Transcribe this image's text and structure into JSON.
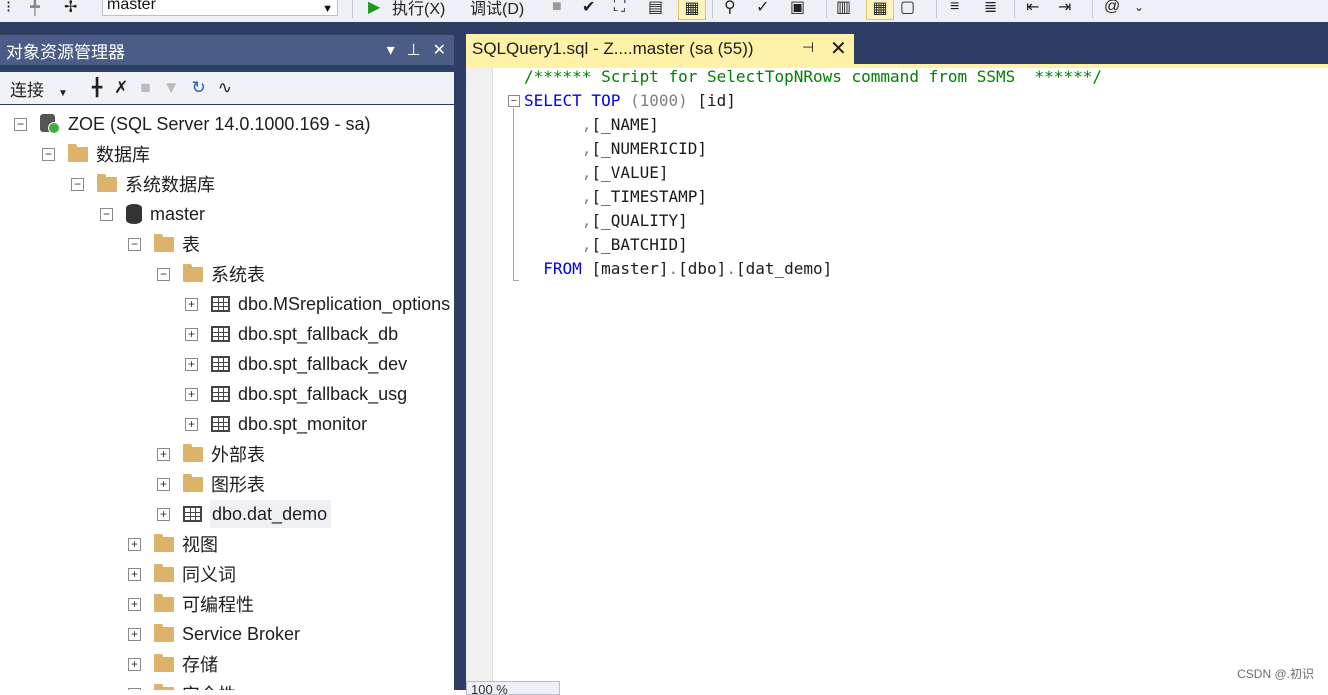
{
  "toolbar": {
    "database_combo": "master",
    "execute_label": "执行(X)",
    "debug_label": "调试(D)"
  },
  "object_explorer": {
    "title": "对象资源管理器",
    "connect_label": "连接",
    "tree": [
      {
        "label": "ZOE (SQL Server 14.0.1000.169 - sa)",
        "icon": "server-icon",
        "expander": "minus"
      },
      {
        "label": "数据库",
        "icon": "folder-icon",
        "expander": "minus"
      },
      {
        "label": "系统数据库",
        "icon": "folder-icon",
        "expander": "minus"
      },
      {
        "label": "master",
        "icon": "database-icon",
        "expander": "minus"
      },
      {
        "label": "表",
        "icon": "folder-icon",
        "expander": "minus"
      },
      {
        "label": "系统表",
        "icon": "folder-icon",
        "expander": "minus"
      },
      {
        "label": "dbo.MSreplication_options",
        "icon": "table-icon",
        "expander": "plus"
      },
      {
        "label": "dbo.spt_fallback_db",
        "icon": "table-icon",
        "expander": "plus"
      },
      {
        "label": "dbo.spt_fallback_dev",
        "icon": "table-icon",
        "expander": "plus"
      },
      {
        "label": "dbo.spt_fallback_usg",
        "icon": "table-icon",
        "expander": "plus"
      },
      {
        "label": "dbo.spt_monitor",
        "icon": "table-icon",
        "expander": "plus"
      },
      {
        "label": "外部表",
        "icon": "folder-icon",
        "expander": "plus"
      },
      {
        "label": "图形表",
        "icon": "folder-icon",
        "expander": "plus"
      },
      {
        "label": "dbo.dat_demo",
        "icon": "table-icon",
        "expander": "plus",
        "selected": true
      },
      {
        "label": "视图",
        "icon": "folder-icon",
        "expander": "plus"
      },
      {
        "label": "同义词",
        "icon": "folder-icon",
        "expander": "plus"
      },
      {
        "label": "可编程性",
        "icon": "folder-icon",
        "expander": "plus"
      },
      {
        "label": "Service Broker",
        "icon": "folder-icon",
        "expander": "plus"
      },
      {
        "label": "存储",
        "icon": "folder-icon",
        "expander": "plus"
      },
      {
        "label": "安全性",
        "icon": "folder-icon",
        "expander": "plus"
      }
    ]
  },
  "document": {
    "tab_title": "SQLQuery1.sql - Z....master (sa (55))",
    "zoom": "100 %",
    "code_lines": [
      "/****** Script for SelectTopNRows command from SSMS  ******/",
      "SELECT TOP (1000) [id]",
      "      ,[_NAME]",
      "      ,[_NUMERICID]",
      "      ,[_VALUE]",
      "      ,[_TIMESTAMP]",
      "      ,[_QUALITY]",
      "      ,[_BATCHID]",
      "  FROM [master].[dbo].[dat_demo]"
    ]
  },
  "watermark": "CSDN @.初识"
}
